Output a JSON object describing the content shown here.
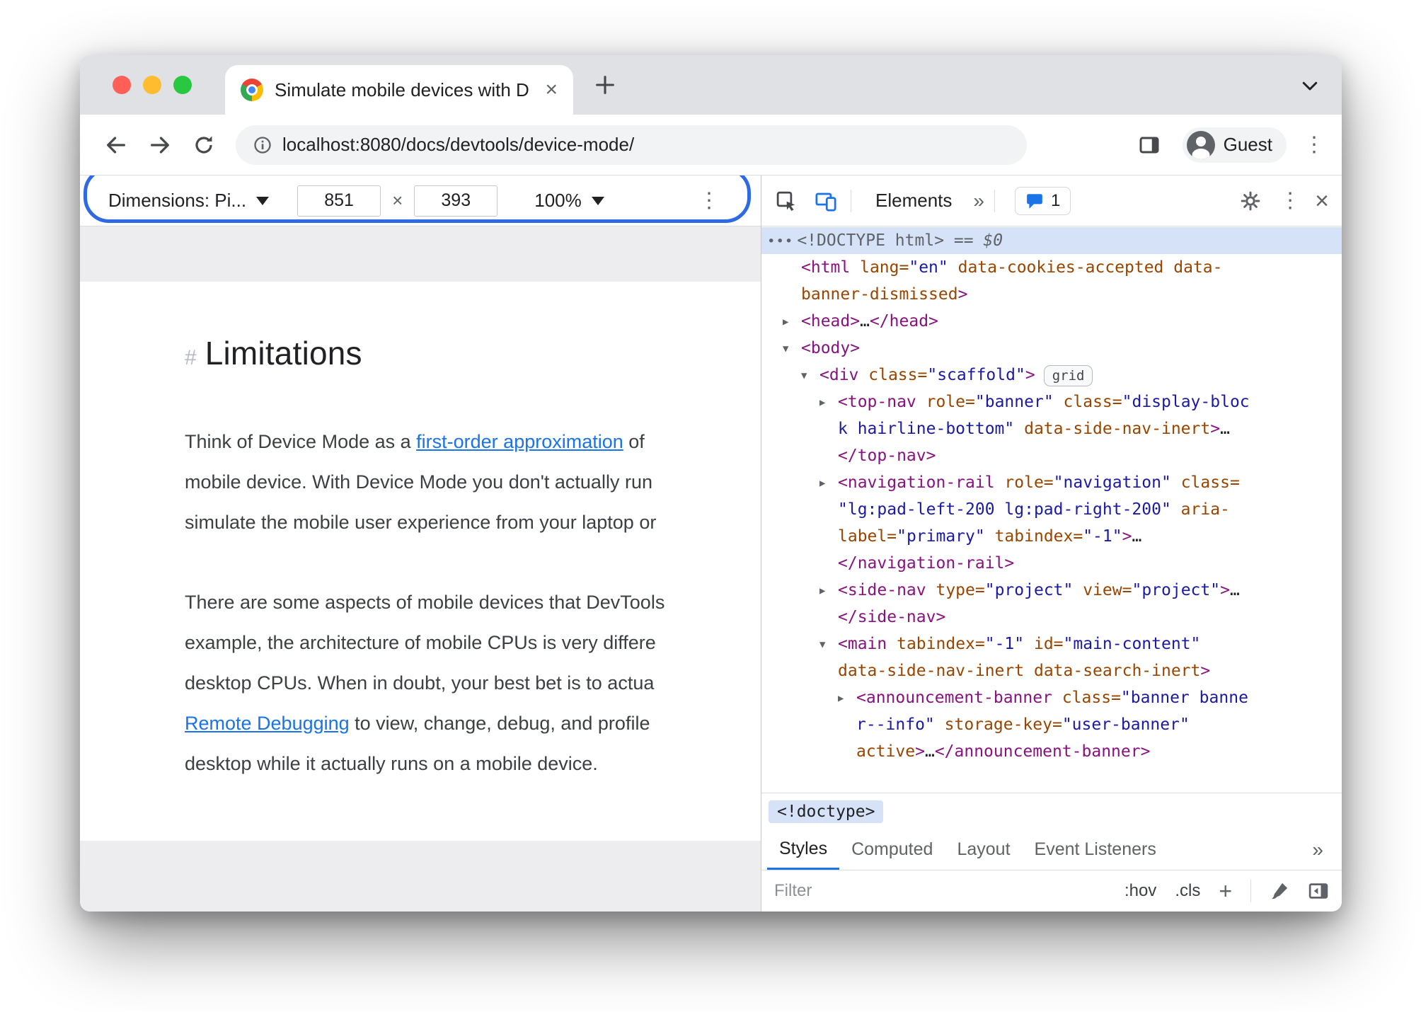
{
  "window": {
    "tab_title": "Simulate mobile devices with D",
    "url": "localhost:8080/docs/devtools/device-mode/",
    "profile_label": "Guest"
  },
  "icons": {
    "kebab": "⋮",
    "double_chevron": "»",
    "close_x": "×"
  },
  "device_toolbar": {
    "dimensions_label": "Dimensions: Pi...",
    "width": "851",
    "separator": "×",
    "height": "393",
    "zoom": "100%"
  },
  "page": {
    "heading_marker": "#",
    "heading": "Limitations",
    "paragraphs": [
      {
        "lines": [
          [
            {
              "text": "Think of Device Mode as a "
            },
            {
              "text": "first-order approximation",
              "link": true
            },
            {
              "text": " of "
            }
          ],
          [
            {
              "text": "mobile device. With Device Mode you don't actually run "
            }
          ],
          [
            {
              "text": "simulate the mobile user experience from your laptop or "
            }
          ]
        ]
      },
      {
        "lines": [
          [
            {
              "text": "There are some aspects of mobile devices that DevTools"
            }
          ],
          [
            {
              "text": "example, the architecture of mobile CPUs is very differe"
            }
          ],
          [
            {
              "text": "desktop CPUs. When in doubt, your best bet is to actua"
            }
          ],
          [
            {
              "text": "Remote Debugging",
              "link": true
            },
            {
              "text": " to view, change, debug, and profile "
            }
          ],
          [
            {
              "text": "desktop while it actually runs on a mobile device."
            }
          ]
        ]
      }
    ]
  },
  "devtools": {
    "panel_tab": "Elements",
    "issues_count": "1",
    "breadcrumb": "<!doctype>",
    "styles_tabs": [
      "Styles",
      "Computed",
      "Layout",
      "Event Listeners"
    ],
    "filter_placeholder": "Filter",
    "hov": ":hov",
    "cls": ".cls",
    "colors": {
      "accent_blue": "#1a73e8",
      "selection": "#d6e2f7",
      "tag": "#881280",
      "attr": "#994500",
      "value": "#1a1aa6"
    },
    "tree": {
      "rows": [
        {
          "sel": true,
          "pl": 8,
          "indent": 0,
          "gutter": "•••",
          "tokens": [
            [
              "g",
              "<!DOCTYPE html> "
            ],
            [
              "gi",
              "== $0"
            ]
          ]
        },
        {
          "indent": 0,
          "tokens": [
            [
              "t",
              "<html"
            ],
            [
              "n",
              " "
            ],
            [
              "a",
              "lang="
            ],
            [
              "v",
              "\"en\""
            ],
            [
              "n",
              " "
            ],
            [
              "a",
              "data-cookies-accepted"
            ],
            [
              "n",
              " "
            ],
            [
              "a",
              "data-"
            ]
          ]
        },
        {
          "indent": 0,
          "tokens": [
            [
              "a",
              "banner-dismissed"
            ],
            [
              "t",
              ">"
            ]
          ]
        },
        {
          "indent": 0,
          "arrow": "right",
          "tokens": [
            [
              "t",
              "<head>"
            ],
            [
              "d",
              "…"
            ],
            [
              "t",
              "</head>"
            ]
          ]
        },
        {
          "indent": 0,
          "arrow": "down",
          "tokens": [
            [
              "t",
              "<body>"
            ]
          ]
        },
        {
          "indent": 1,
          "arrow": "down",
          "badge": "grid",
          "tokens": [
            [
              "t",
              "<div"
            ],
            [
              "n",
              " "
            ],
            [
              "a",
              "class="
            ],
            [
              "v",
              "\"scaffold\""
            ],
            [
              "t",
              ">"
            ]
          ]
        },
        {
          "indent": 2,
          "arrow": "right",
          "tokens": [
            [
              "t",
              "<top-nav"
            ],
            [
              "n",
              " "
            ],
            [
              "a",
              "role="
            ],
            [
              "v",
              "\"banner\""
            ],
            [
              "n",
              " "
            ],
            [
              "a",
              "class="
            ],
            [
              "v",
              "\"display-bloc"
            ]
          ]
        },
        {
          "indent": 2,
          "tokens": [
            [
              "v",
              "k hairline-bottom\""
            ],
            [
              "n",
              " "
            ],
            [
              "a",
              "data-side-nav-inert"
            ],
            [
              "t",
              ">"
            ],
            [
              "d",
              "…"
            ]
          ]
        },
        {
          "indent": 2,
          "tokens": [
            [
              "t",
              "</top-nav>"
            ]
          ]
        },
        {
          "indent": 2,
          "arrow": "right",
          "tokens": [
            [
              "t",
              "<navigation-rail"
            ],
            [
              "n",
              " "
            ],
            [
              "a",
              "role="
            ],
            [
              "v",
              "\"navigation\""
            ],
            [
              "n",
              " "
            ],
            [
              "a",
              "class="
            ]
          ]
        },
        {
          "indent": 2,
          "tokens": [
            [
              "v",
              "\"lg:pad-left-200 lg:pad-right-200\""
            ],
            [
              "n",
              " "
            ],
            [
              "a",
              "aria-"
            ]
          ]
        },
        {
          "indent": 2,
          "tokens": [
            [
              "a",
              "label="
            ],
            [
              "v",
              "\"primary\""
            ],
            [
              "n",
              " "
            ],
            [
              "a",
              "tabindex="
            ],
            [
              "v",
              "\"-1\""
            ],
            [
              "t",
              ">"
            ],
            [
              "d",
              "…"
            ]
          ]
        },
        {
          "indent": 2,
          "tokens": [
            [
              "t",
              "</navigation-rail>"
            ]
          ]
        },
        {
          "indent": 2,
          "arrow": "right",
          "tokens": [
            [
              "t",
              "<side-nav"
            ],
            [
              "n",
              " "
            ],
            [
              "a",
              "type="
            ],
            [
              "v",
              "\"project\""
            ],
            [
              "n",
              " "
            ],
            [
              "a",
              "view="
            ],
            [
              "v",
              "\"project\""
            ],
            [
              "t",
              ">"
            ],
            [
              "d",
              "…"
            ]
          ]
        },
        {
          "indent": 2,
          "tokens": [
            [
              "t",
              "</side-nav>"
            ]
          ]
        },
        {
          "indent": 2,
          "arrow": "down",
          "tokens": [
            [
              "t",
              "<main"
            ],
            [
              "n",
              " "
            ],
            [
              "a",
              "tabindex="
            ],
            [
              "v",
              "\"-1\""
            ],
            [
              "n",
              " "
            ],
            [
              "a",
              "id="
            ],
            [
              "v",
              "\"main-content\""
            ]
          ]
        },
        {
          "indent": 2,
          "tokens": [
            [
              "a",
              "data-side-nav-inert"
            ],
            [
              "n",
              " "
            ],
            [
              "a",
              "data-search-inert"
            ],
            [
              "t",
              ">"
            ]
          ]
        },
        {
          "indent": 3,
          "arrow": "right",
          "tokens": [
            [
              "t",
              "<announcement-banner"
            ],
            [
              "n",
              " "
            ],
            [
              "a",
              "class="
            ],
            [
              "v",
              "\"banner banne"
            ]
          ]
        },
        {
          "indent": 3,
          "tokens": [
            [
              "v",
              "r--info\""
            ],
            [
              "n",
              " "
            ],
            [
              "a",
              "storage-key="
            ],
            [
              "v",
              "\"user-banner\""
            ]
          ]
        },
        {
          "indent": 3,
          "tokens": [
            [
              "a",
              "active"
            ],
            [
              "t",
              ">"
            ],
            [
              "d",
              "…"
            ],
            [
              "t",
              "</announcement-banner>"
            ]
          ]
        }
      ]
    }
  }
}
